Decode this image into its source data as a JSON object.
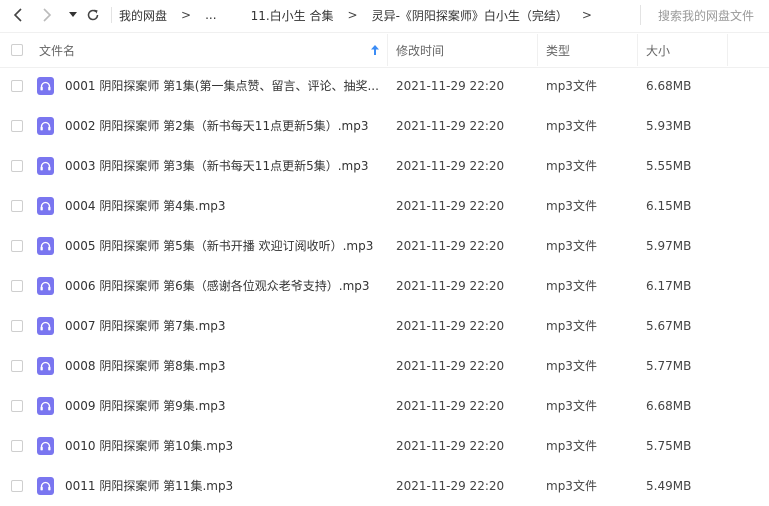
{
  "nav": {
    "back_icon": "chevron-left-icon",
    "forward_icon": "chevron-right-icon",
    "dropdown_icon": "caret-down-icon",
    "refresh_icon": "refresh-icon"
  },
  "breadcrumb": {
    "items": [
      "我的网盘",
      "...",
      "11.白小生 合集",
      "灵异-《阴阳探案师》白小生（完结）"
    ],
    "separator": ">"
  },
  "search": {
    "placeholder": "搜索我的网盘文件"
  },
  "table": {
    "headers": {
      "name": "文件名",
      "modified": "修改时间",
      "type": "类型",
      "size": "大小"
    },
    "sort_icon": "arrow-up-icon",
    "rows": [
      {
        "name": "0001 阴阳探案师 第1集(第一集点赞、留言、评论、抽奖...",
        "modified": "2021-11-29 22:20",
        "type": "mp3文件",
        "size": "6.68MB"
      },
      {
        "name": "0002 阴阳探案师 第2集（新书每天11点更新5集）.mp3",
        "modified": "2021-11-29 22:20",
        "type": "mp3文件",
        "size": "5.93MB"
      },
      {
        "name": "0003 阴阳探案师 第3集（新书每天11点更新5集）.mp3",
        "modified": "2021-11-29 22:20",
        "type": "mp3文件",
        "size": "5.55MB"
      },
      {
        "name": "0004 阴阳探案师 第4集.mp3",
        "modified": "2021-11-29 22:20",
        "type": "mp3文件",
        "size": "6.15MB"
      },
      {
        "name": "0005 阴阳探案师 第5集（新书开播 欢迎订阅收听）.mp3",
        "modified": "2021-11-29 22:20",
        "type": "mp3文件",
        "size": "5.97MB"
      },
      {
        "name": "0006 阴阳探案师 第6集（感谢各位观众老爷支持）.mp3",
        "modified": "2021-11-29 22:20",
        "type": "mp3文件",
        "size": "6.17MB"
      },
      {
        "name": "0007 阴阳探案师 第7集.mp3",
        "modified": "2021-11-29 22:20",
        "type": "mp3文件",
        "size": "5.67MB"
      },
      {
        "name": "0008 阴阳探案师 第8集.mp3",
        "modified": "2021-11-29 22:20",
        "type": "mp3文件",
        "size": "5.77MB"
      },
      {
        "name": "0009 阴阳探案师 第9集.mp3",
        "modified": "2021-11-29 22:20",
        "type": "mp3文件",
        "size": "6.68MB"
      },
      {
        "name": "0010 阴阳探案师 第10集.mp3",
        "modified": "2021-11-29 22:20",
        "type": "mp3文件",
        "size": "5.75MB"
      },
      {
        "name": "0011 阴阳探案师 第11集.mp3",
        "modified": "2021-11-29 22:20",
        "type": "mp3文件",
        "size": "5.49MB"
      }
    ]
  },
  "colors": {
    "audio_icon": "#7a76f0",
    "sort_arrow": "#3b8cf5"
  }
}
